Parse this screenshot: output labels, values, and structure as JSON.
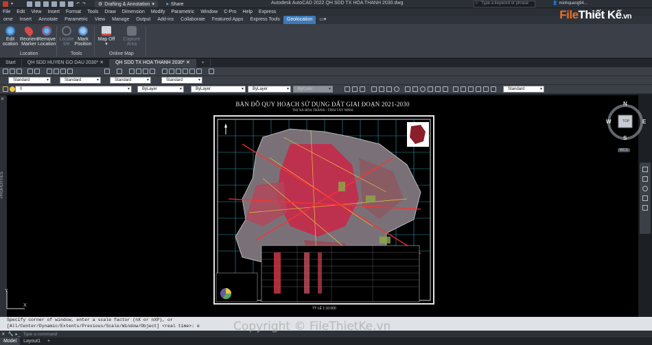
{
  "titlebar": {
    "workspace": "Drafting & Annotation",
    "share": "Share",
    "app_title": "Autodesk AutoCAD 2022    QH SDD TX HOA THANH 2030.dwg",
    "search_placeholder": "Type a keyword or phrase",
    "user": "minhquang94..."
  },
  "logo": {
    "text_a": "File",
    "text_b": "Thiết Kế",
    "text_c": ".vn"
  },
  "menu": [
    "File",
    "Edit",
    "View",
    "Insert",
    "Format",
    "Tools",
    "Draw",
    "Dimension",
    "Modify",
    "Parametric",
    "Window",
    "C-Pro",
    "Help",
    "Express"
  ],
  "ribbon_tabs": [
    "ome",
    "Insert",
    "Annotate",
    "Parametric",
    "View",
    "Manage",
    "Output",
    "Add-ins",
    "Collaborate",
    "Featured Apps",
    "Express Tools",
    "Geolocation"
  ],
  "ribbon_active": "Geolocation",
  "ribbon": {
    "buttons": [
      {
        "label": "Edit",
        "label2": "ocation"
      },
      {
        "label": "Reorient",
        "label2": "Marker"
      },
      {
        "label": "Remove",
        "label2": "Location"
      },
      {
        "label": "Locate",
        "label2": "Me"
      },
      {
        "label": "Mark",
        "label2": "Position"
      },
      {
        "label": "Map Off",
        "label2": ""
      },
      {
        "label": "Capture",
        "label2": "Area"
      }
    ],
    "panels": [
      "Location",
      "Tools",
      "Online Map"
    ]
  },
  "doc_tabs": [
    "Start",
    "QH SDD HUYEN GO DAU 2030*",
    "QH SDD TX HOA THANH 2030*"
  ],
  "doc_active": "QH SDD TX HOA THANH 2030*",
  "toolbar": {
    "text_style": "Standard",
    "dim_style": "Standard",
    "table_style": "Standard",
    "mleader_style": "Standard",
    "layer": "0",
    "color": "ByLayer",
    "linetype": "ByLayer",
    "lineweight": "ByLayer",
    "plotstyle": "ByColor",
    "visual": "Standard"
  },
  "map": {
    "title": "BẢN ĐỒ QUY HOẠCH SỬ DỤNG ĐẤT GIAI ĐOẠN 2021-2030",
    "subtitle": "THỊ XÃ HÒA THÀNH - TỈNH TÂY NINH",
    "scale": "TỶ LỆ 1:10.000"
  },
  "viewcube": {
    "n": "N",
    "s": "S",
    "e": "E",
    "w": "W",
    "top": "TOP",
    "wcs": "WCS"
  },
  "properties_label": "PROPERTIES",
  "command": {
    "line1": "Specify corner of window, enter a scale factor (nX or nXP), or",
    "line2": "[All/Center/Dynamic/Extents/Previous/Scale/Window/Object] <real time>: e",
    "placeholder": "Type a command"
  },
  "layout_tabs": [
    "Model",
    "Layout1"
  ],
  "watermark": "Copyright © FileThietKe.vn",
  "colors": {
    "accent": "#3d7ab8",
    "canvas": "#000000",
    "ribbon": "#3b4048"
  }
}
